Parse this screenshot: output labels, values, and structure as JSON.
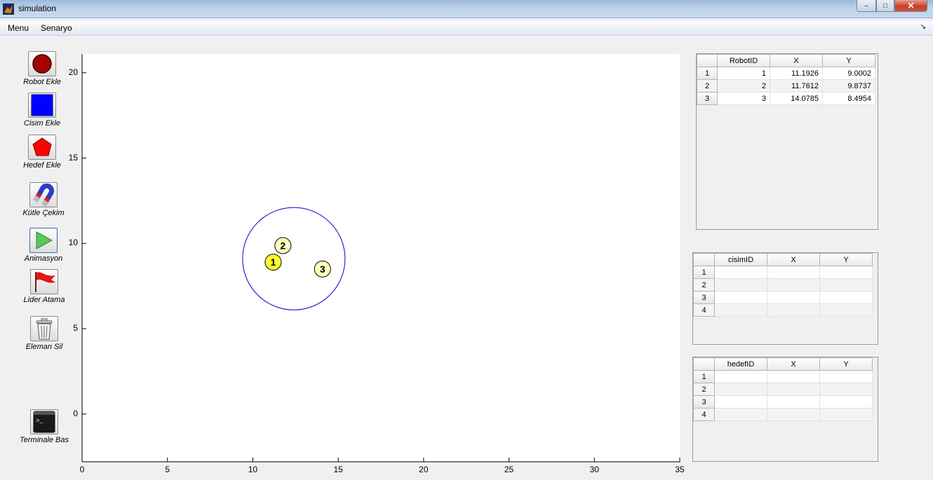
{
  "window": {
    "title": "simulation"
  },
  "menubar": {
    "items": [
      "Menu",
      "Senaryo"
    ]
  },
  "tools": [
    {
      "label": "Robot Ekle",
      "icon": "robot-red-circle-icon"
    },
    {
      "label": "Cisim Ekle",
      "icon": "blue-square-icon"
    },
    {
      "label": "Hedef Ekle",
      "icon": "red-pentagon-icon"
    },
    {
      "label": "Kütle Çekim",
      "icon": "magnet-icon"
    },
    {
      "label": "Animasyon",
      "icon": "play-icon"
    },
    {
      "label": "Lider Atama",
      "icon": "red-flag-icon"
    },
    {
      "label": "Eleman Sil",
      "icon": "trash-icon"
    },
    {
      "label": "Terminale Bas",
      "icon": "terminal-icon"
    }
  ],
  "plot": {
    "xlim": [
      0,
      35
    ],
    "ylim": [
      -2.8,
      21.1
    ],
    "xticks": [
      "0",
      "5",
      "10",
      "15",
      "20",
      "25",
      "30",
      "35"
    ],
    "yticks": [
      "0",
      "5",
      "10",
      "15",
      "20"
    ],
    "circle": {
      "cx": 12.4,
      "cy": 9.1,
      "r": 3.0,
      "color": "#0000c8"
    },
    "robots": [
      {
        "label": "1",
        "x": 11.19,
        "y": 8.9,
        "fill": "#ffff33"
      },
      {
        "label": "2",
        "x": 11.76,
        "y": 9.87,
        "fill": "#ffffbb"
      },
      {
        "label": "3",
        "x": 14.08,
        "y": 8.5,
        "fill": "#ffffbb"
      }
    ]
  },
  "robot_table": {
    "headers": [
      "RobotID",
      "X",
      "Y"
    ],
    "rows": [
      {
        "n": "1",
        "cells": [
          "1",
          "11.1926",
          "9.0002"
        ]
      },
      {
        "n": "2",
        "cells": [
          "2",
          "11.7612",
          "9.8737"
        ]
      },
      {
        "n": "3",
        "cells": [
          "3",
          "14.0785",
          "8.4954"
        ]
      }
    ]
  },
  "cisim_table": {
    "headers": [
      "cisimID",
      "X",
      "Y"
    ],
    "rows": [
      {
        "n": "1",
        "cells": [
          "",
          "",
          ""
        ]
      },
      {
        "n": "2",
        "cells": [
          "",
          "",
          ""
        ]
      },
      {
        "n": "3",
        "cells": [
          "",
          "",
          ""
        ]
      },
      {
        "n": "4",
        "cells": [
          "",
          "",
          ""
        ]
      }
    ]
  },
  "hedef_table": {
    "headers": [
      "hedefID",
      "X",
      "Y"
    ],
    "rows": [
      {
        "n": "1",
        "cells": [
          "",
          "",
          ""
        ]
      },
      {
        "n": "2",
        "cells": [
          "",
          "",
          ""
        ]
      },
      {
        "n": "3",
        "cells": [
          "",
          "",
          ""
        ]
      },
      {
        "n": "4",
        "cells": [
          "",
          "",
          ""
        ]
      }
    ]
  }
}
